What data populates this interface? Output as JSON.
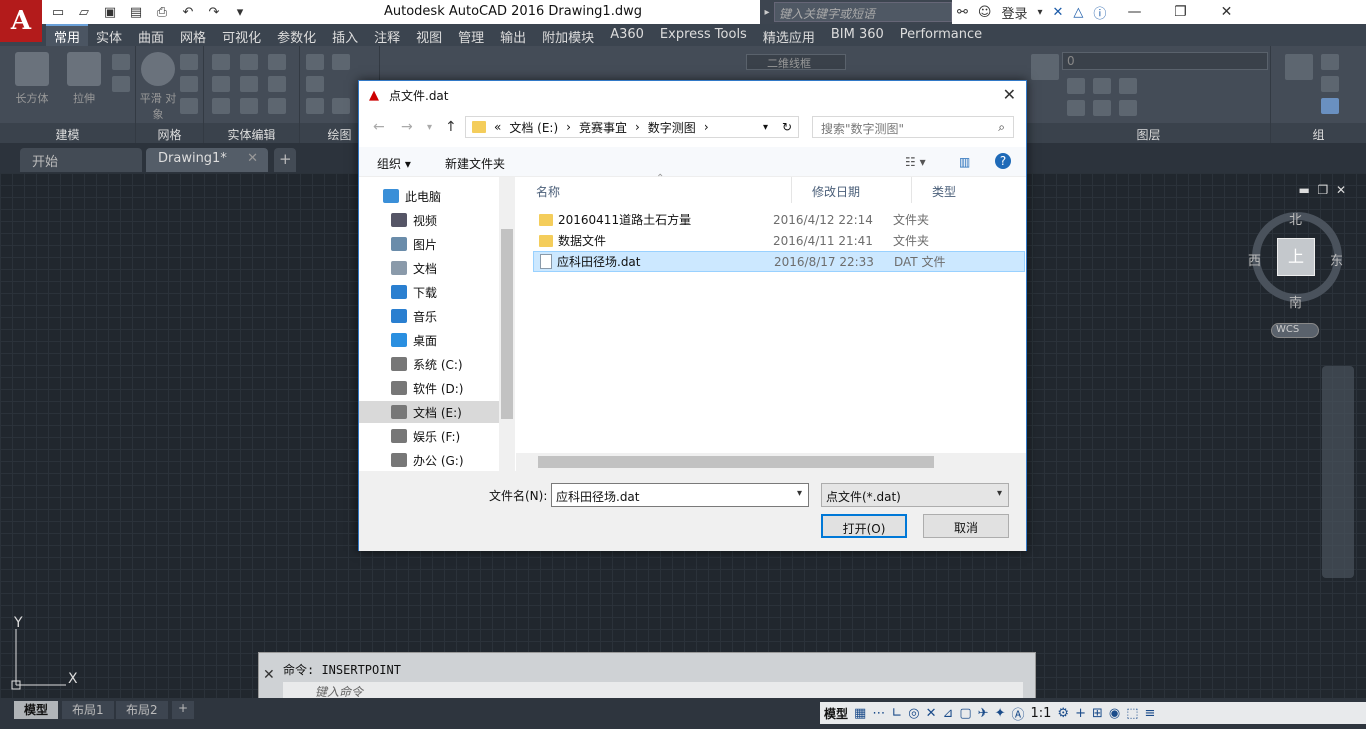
{
  "app": {
    "title": "Autodesk AutoCAD 2016    Drawing1.dwg",
    "search_placeholder": "键入关键字或短语",
    "login_label": "登录"
  },
  "ribbon_tabs": [
    "常用",
    "实体",
    "曲面",
    "网格",
    "可视化",
    "参数化",
    "插入",
    "注释",
    "视图",
    "管理",
    "输出",
    "附加模块",
    "A360",
    "Express Tools",
    "精选应用",
    "BIM 360",
    "Performance"
  ],
  "ribbon_groups": {
    "model": "建模",
    "mesh": "网格",
    "solid_edit": "实体编辑",
    "draw": "绘图",
    "layers": "图层",
    "groups": "组",
    "box_label": "长方体",
    "extrude_label": "拉伸",
    "smooth_label": "平滑\n对象",
    "view_style": "二维线框",
    "layer_value": "0"
  },
  "doc_tabs": [
    "开始",
    "Drawing1*"
  ],
  "viewcube": {
    "top": "上",
    "north": "北",
    "south": "南",
    "east": "东",
    "west": "西",
    "wcs": "WCS"
  },
  "ucs": {
    "x": "X",
    "y": "Y"
  },
  "command": {
    "history": "命令: INSERTPOINT",
    "input_placeholder": "键入命令"
  },
  "layout_tabs": [
    "模型",
    "布局1",
    "布局2"
  ],
  "status": {
    "model": "模型",
    "scale": "1:1"
  },
  "dialog": {
    "title": "点文件.dat",
    "breadcrumb": [
      "«",
      "文档 (E:)",
      "›",
      "竞赛事宜",
      "›",
      "数字测图",
      "›"
    ],
    "search_placeholder": "搜索\"数字测图\"",
    "organize": "组织 ▾",
    "new_folder": "新建文件夹",
    "nav_items": [
      {
        "label": "此电脑",
        "color": "#3a8fd8"
      },
      {
        "label": "视频",
        "color": "#556"
      },
      {
        "label": "图片",
        "color": "#6a8caa"
      },
      {
        "label": "文档",
        "color": "#8a9aaa"
      },
      {
        "label": "下载",
        "color": "#2a7fd0"
      },
      {
        "label": "音乐",
        "color": "#2a7fd0"
      },
      {
        "label": "桌面",
        "color": "#2a8fe0"
      },
      {
        "label": "系统 (C:)",
        "color": "#777"
      },
      {
        "label": "软件 (D:)",
        "color": "#777"
      },
      {
        "label": "文档 (E:)",
        "color": "#777"
      },
      {
        "label": "娱乐 (F:)",
        "color": "#777"
      },
      {
        "label": "办公 (G:)",
        "color": "#777"
      }
    ],
    "columns": [
      "名称",
      "修改日期",
      "类型"
    ],
    "files": [
      {
        "name": "20160411道路土石方量",
        "date": "2016/4/12 22:14",
        "type": "文件夹",
        "kind": "folder"
      },
      {
        "name": "数据文件",
        "date": "2016/4/11 21:41",
        "type": "文件夹",
        "kind": "folder"
      },
      {
        "name": "应科田径场.dat",
        "date": "2016/8/17 22:33",
        "type": "DAT 文件",
        "kind": "file"
      }
    ],
    "filename_label": "文件名(N):",
    "filename_value": "应科田径场.dat",
    "filetype_value": "点文件(*.dat)",
    "open_label": "打开(O)",
    "cancel_label": "取消"
  }
}
